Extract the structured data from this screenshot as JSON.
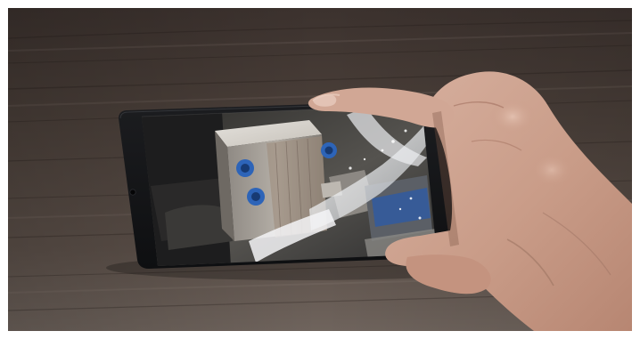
{
  "scene": {
    "subject": "hand-holding-smartphone",
    "screen_content": "cnc-milling-video",
    "colors": {
      "table_dark": "#2f2622",
      "table_mid": "#4a3e38",
      "table_light": "#6e625b",
      "phone_body": "#121314",
      "screen_metal": "#a9a39a",
      "skin": "#cfa694",
      "skin_shadow": "#9d7463",
      "coolant": "#f1f2f4",
      "fixture_blue": "#2d64b8"
    }
  }
}
